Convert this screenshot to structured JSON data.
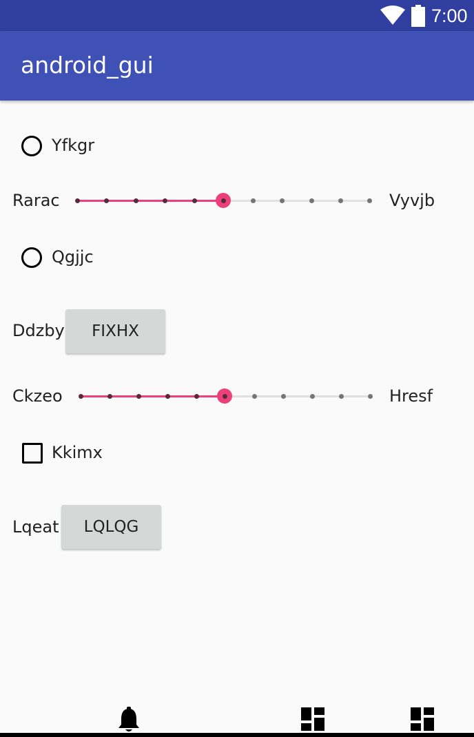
{
  "status_bar": {
    "time": "7:00",
    "wifi_icon": "wifi-icon",
    "battery_icon": "battery-icon"
  },
  "app_bar": {
    "title": "android_gui"
  },
  "content": {
    "radio_1": {
      "label": "Yfkgr",
      "checked": false
    },
    "slider_1": {
      "left_label": "Rarac",
      "right_label": "Vyvjb",
      "steps": 10,
      "value": 5
    },
    "radio_2": {
      "label": "Qgjjc",
      "checked": false
    },
    "button_row_1": {
      "label": "Ddzby",
      "button_label": "FIXHX"
    },
    "slider_2": {
      "left_label": "Ckzeo",
      "right_label": "Hresf",
      "steps": 10,
      "value": 5
    },
    "checkbox_1": {
      "label": "Kkimx",
      "checked": false
    },
    "button_row_2": {
      "label": "Lqeat",
      "button_label": "LQLQG"
    }
  },
  "bottom_nav": {
    "items": [
      {
        "icon": "bell-icon"
      },
      {
        "icon": "dashboard-icon"
      },
      {
        "icon": "dashboard-icon"
      }
    ]
  },
  "colors": {
    "status_bar": "#303f9f",
    "app_bar": "#3f51b5",
    "accent": "#ec407a",
    "button": "#d6d7d7"
  }
}
